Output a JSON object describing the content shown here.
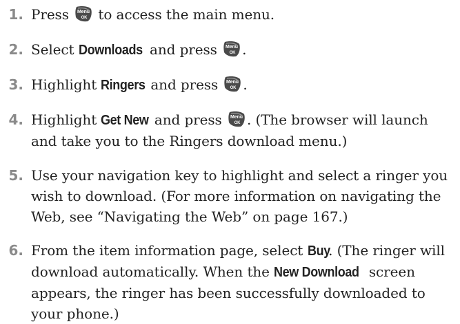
{
  "steps": [
    {
      "number": "1.",
      "parts": [
        {
          "t": "text",
          "v": "Press "
        },
        {
          "t": "key",
          "icon": "menu-ok-key-icon",
          "label": "Menu OK"
        },
        {
          "t": "text",
          "v": " to access the main menu."
        }
      ]
    },
    {
      "number": "2.",
      "parts": [
        {
          "t": "text",
          "v": "Select "
        },
        {
          "t": "bold",
          "v": "Downloads"
        },
        {
          "t": "text",
          "v": " and press "
        },
        {
          "t": "key",
          "icon": "menu-ok-key-icon",
          "label": "Menu OK"
        },
        {
          "t": "text",
          "v": "."
        }
      ]
    },
    {
      "number": "3.",
      "parts": [
        {
          "t": "text",
          "v": "Highlight "
        },
        {
          "t": "bold",
          "v": "Ringers"
        },
        {
          "t": "text",
          "v": " and press "
        },
        {
          "t": "key",
          "icon": "menu-ok-key-icon",
          "label": "Menu OK"
        },
        {
          "t": "text",
          "v": "."
        }
      ]
    },
    {
      "number": "4.",
      "parts": [
        {
          "t": "text",
          "v": "Highlight "
        },
        {
          "t": "bold",
          "v": "Get New"
        },
        {
          "t": "text",
          "v": " and press "
        },
        {
          "t": "key",
          "icon": "menu-ok-key-icon",
          "label": "Menu OK"
        },
        {
          "t": "text",
          "v": ". (The browser will launch and take you to the Ringers download menu.)"
        }
      ]
    },
    {
      "number": "5.",
      "parts": [
        {
          "t": "text",
          "v": "Use your navigation key to highlight and select a ringer you wish to download. (For more information on navigating the Web, see “Navigating the Web” on page 167.)"
        }
      ]
    },
    {
      "number": "6.",
      "parts": [
        {
          "t": "text",
          "v": "From the item information page, select "
        },
        {
          "t": "bold",
          "v": "Buy"
        },
        {
          "t": "text",
          "v": ". (The ringer will download automatically. When the "
        },
        {
          "t": "bold",
          "v": "New Download"
        },
        {
          "t": "text",
          "v": " screen appears, the ringer has been successfully downloaded to your phone.)"
        }
      ]
    }
  ],
  "colors": {
    "number": "#8a8a8a",
    "text": "#222222",
    "key_fill": "#4a4a4a",
    "key_text": "#ffffff"
  }
}
